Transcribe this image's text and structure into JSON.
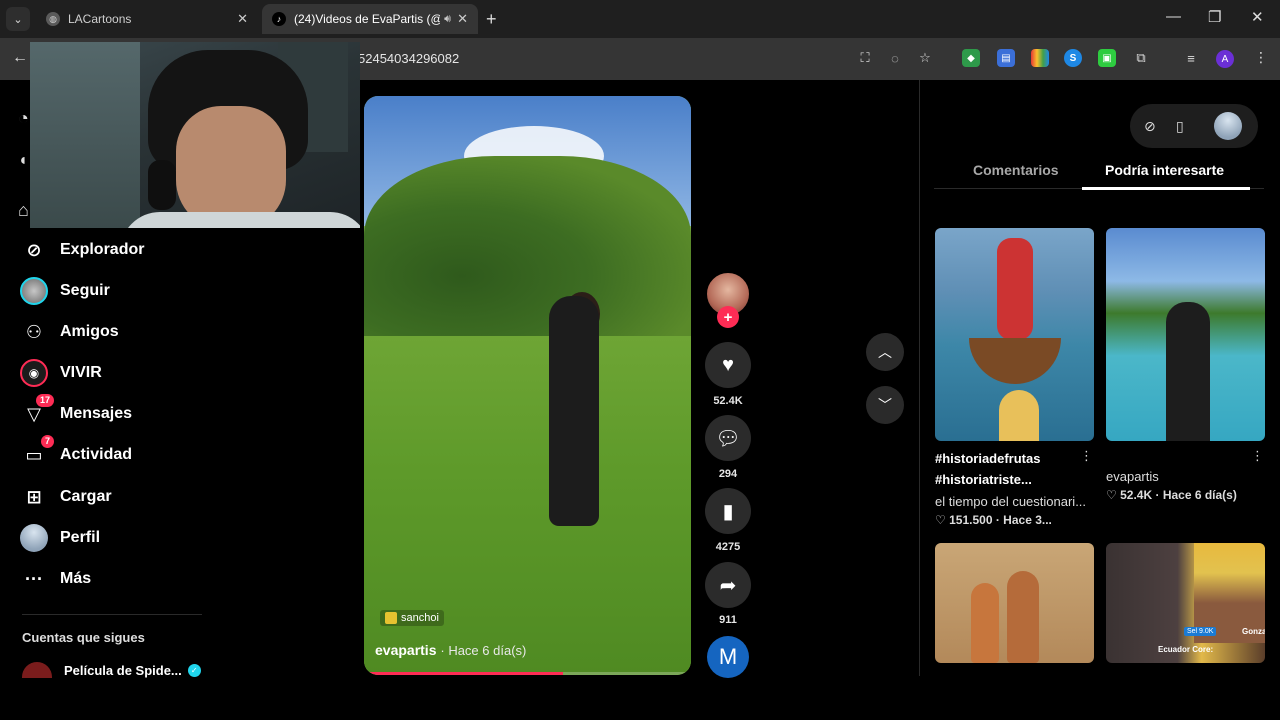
{
  "browser": {
    "tabs": [
      {
        "title": "LACartoons",
        "active": false
      },
      {
        "title": "(24)Videos de EvaPartis (@e",
        "active": true
      }
    ],
    "url": "52454034296082",
    "profile_initial": "A"
  },
  "sidebar": {
    "items": [
      {
        "label": "Explorador",
        "icon": "compass-icon"
      },
      {
        "label": "Seguir",
        "icon": "avatar"
      },
      {
        "label": "Amigos",
        "icon": "friends-icon"
      },
      {
        "label": "VIVIR",
        "icon": "live-icon"
      },
      {
        "label": "Mensajes",
        "icon": "inbox-icon",
        "badge": "17"
      },
      {
        "label": "Actividad",
        "icon": "activity-icon",
        "badge": "7"
      },
      {
        "label": "Cargar",
        "icon": "plus-square-icon"
      },
      {
        "label": "Perfil",
        "icon": "profile-avatar"
      },
      {
        "label": "Más",
        "icon": "more-dots-icon"
      }
    ],
    "following_heading": "Cuentas que sigues",
    "following": [
      {
        "name": "Película de Spide...",
        "verified": true
      }
    ]
  },
  "video": {
    "music_tag": "sanchoi",
    "author": "evapartis",
    "date": "· Hace 6 día(s)",
    "progress": 0.61
  },
  "actions": {
    "likes": "52.4K",
    "comments": "294",
    "saves": "4275",
    "shares": "911",
    "bottom_avatar_letter": "M"
  },
  "right_panel": {
    "tabs": [
      {
        "label": "Comentarios",
        "active": false
      },
      {
        "label": "Podría interesarte",
        "active": true
      }
    ],
    "cards": [
      {
        "title_line1": "#historiadefrutas",
        "title_line2": "#historiatriste...",
        "subtitle": "el tiempo del cuestionari...",
        "likes": "151.500",
        "date": "· Hace 3..."
      },
      {
        "author": "evapartis",
        "likes": "52.4K",
        "date": "· Hace 6 día(s)"
      },
      {},
      {
        "overlay_chip": "Sel 9.0K",
        "overlay_name": "Gonza",
        "overlay_caption": "Ecuador Core:"
      }
    ]
  },
  "colors": {
    "accent": "#fe2c55",
    "verified": "#20d5ec",
    "background": "#000000"
  }
}
